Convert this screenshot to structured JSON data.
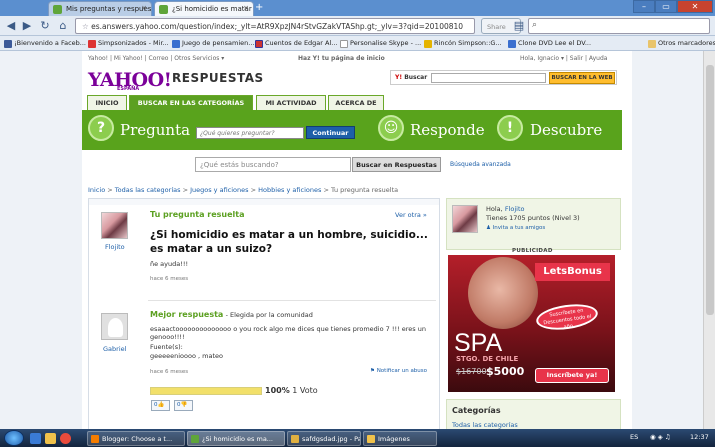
{
  "browser": {
    "tabs": [
      {
        "label": "Mis preguntas y respuest..."
      },
      {
        "label": "¿Si homicidio es matar a ..."
      }
    ],
    "url": "es.answers.yahoo.com/question/index;_ylt=AtR9XpzJN4rStvGZakVTAShp.gt;_ylv=3?qid=20100810",
    "share_label": "Share",
    "bookmarks": [
      "¡Bienvenido a Faceb...",
      "Simpsonizados - Mir...",
      "Juego de pensamien...",
      "Cuentos de Edgar Al...",
      "Personalise Skype - ...",
      "Rincón Simpson::G...",
      "Clone DVD Lee el DV..."
    ],
    "other_bookmarks": "Otros marcadores"
  },
  "yahoo": {
    "topnav_left": "Yahoo! | Mi Yahoo! | Correo | Otros Servicios ▾",
    "topnav_mid": "Haz Y! tu página de inicio",
    "topnav_right": "Hola, Ignacio ▾ | Salir | Ayuda",
    "logo": "YAHOO!",
    "logo_sub": "ESPAÑA",
    "brand": "RESPUESTAS",
    "web_search_label": "Buscar",
    "web_search_btn": "BUSCAR EN LA WEB",
    "nav_tabs": [
      "INICIO",
      "BUSCAR EN LAS CATEGORÍAS",
      "MI ACTIVIDAD",
      "ACERCA DE"
    ],
    "green": {
      "pregunta": "Pregunta",
      "responde": "Responde",
      "descubre": "Descubre",
      "q_placeholder": "¿Qué quieres preguntar?",
      "continue_btn": "Continuar"
    },
    "search_placeholder": "¿Qué estás buscando?",
    "search_btn": "Buscar en Respuestas",
    "advanced": "Búsqueda avanzada"
  },
  "breadcrumb": {
    "items": [
      "Inicio",
      "Todas las categorías",
      "Juegos y aficiones",
      "Hobbies y aficiones"
    ],
    "current": "Tu pregunta resuelta"
  },
  "question": {
    "heading": "Tu pregunta resuelta",
    "see_other": "Ver otra »",
    "asker": "Flojito",
    "title": "¿Si homicidio es matar a un hombre, suicidio... es matar a un suizo?",
    "detail": "ñe ayuda!!!",
    "age": "hace 6 meses"
  },
  "best_answer": {
    "heading": "Mejor respuesta",
    "chosen_by": "- Elegida por la comunidad",
    "user": "Gabriel",
    "text": "esaaactoooooooooooooo o you rock algo me dices que tienes promedio 7 !!! eres un genooo!!!!",
    "sources_label": "Fuente(s):",
    "sources": "geeeeenioooo , mateo",
    "age": "hace 6 meses",
    "report": "Notificar un abuso",
    "vote_percent": "100%",
    "vote_count": "1 Voto",
    "vote_fraction": 1.0,
    "thumbs_up": "0",
    "thumbs_down": "0"
  },
  "sidebar": {
    "hello": "Hola,",
    "user": "Flojito",
    "points": "Tienes 1705 puntos (Nivel 3)",
    "invite": "Invita a tus amigos",
    "ad_label": "PUBLICIDAD",
    "ad": {
      "brand": "LetsBonus",
      "oval": "Suscríbete en Descuentos todo el año",
      "spa": "SPA",
      "city": "STGO. DE CHILE",
      "old_price": "$16700",
      "new_price": "$5000",
      "cta": "Inscríbete ya!"
    },
    "categories_title": "Categorías",
    "categories_first": "Todas las categorías"
  },
  "taskbar": {
    "tasks": [
      "Blogger: Choose a t...",
      "¿Si homicidio es ma...",
      "safdgsdad.jpg - Paint",
      "Imágenes"
    ],
    "lang": "ES",
    "time": "12:37"
  }
}
